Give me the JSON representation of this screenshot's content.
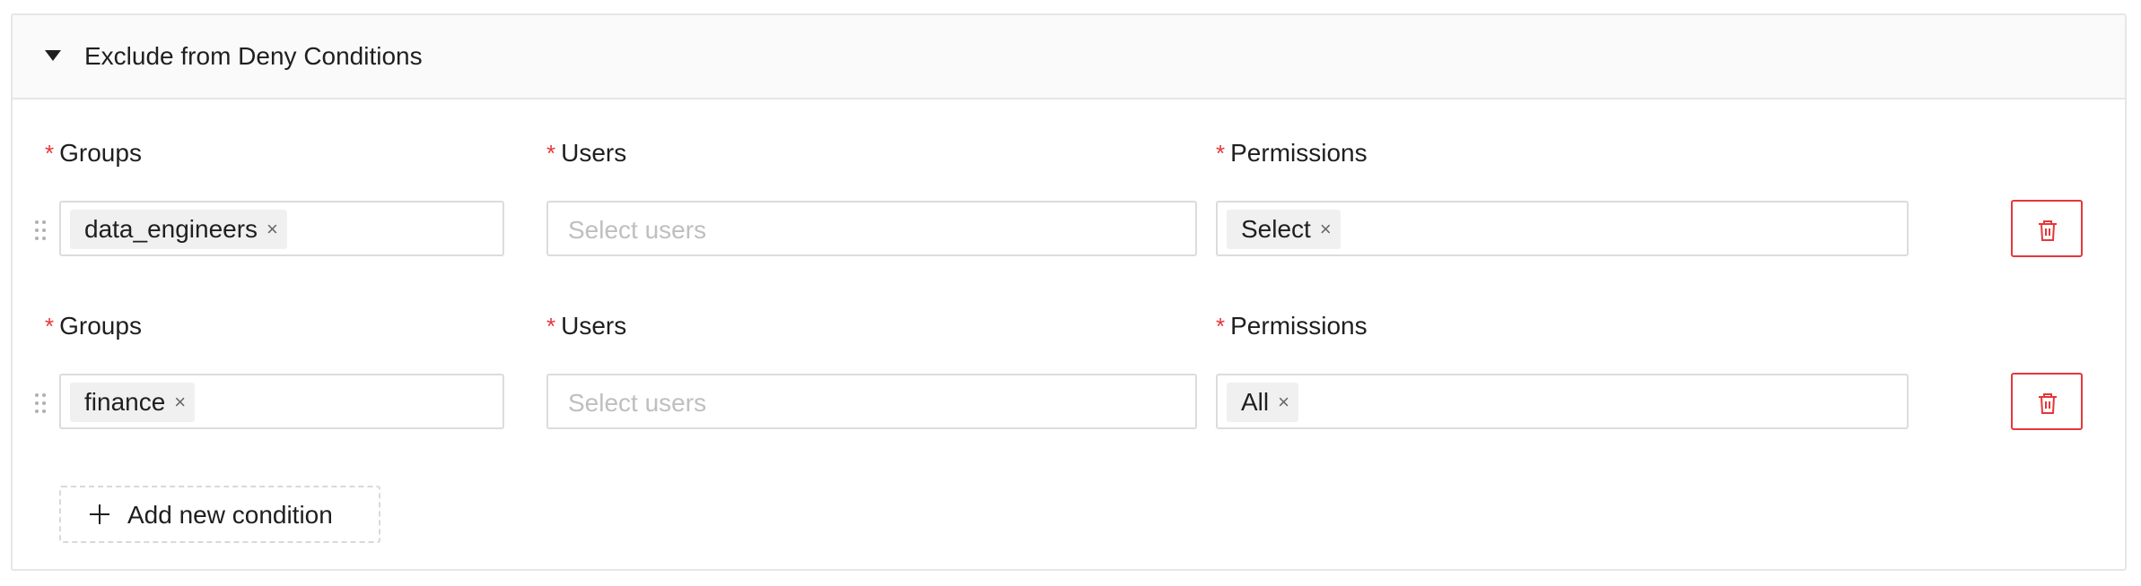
{
  "panel": {
    "title": "Exclude from Deny Conditions",
    "caret_icon": "caret-down-icon"
  },
  "labels": {
    "required_mark": "*",
    "groups": "Groups",
    "users": "Users",
    "permissions": "Permissions"
  },
  "conditions": [
    {
      "groups": [
        "data_engineers"
      ],
      "users_placeholder": "Select users",
      "permissions": [
        "Select"
      ]
    },
    {
      "groups": [
        "finance"
      ],
      "users_placeholder": "Select users",
      "permissions": [
        "All"
      ]
    }
  ],
  "tag_remove_glyph": "×",
  "add_button": {
    "label": "Add new condition",
    "icon": "plus-icon"
  },
  "colors": {
    "required": "#e5373a",
    "danger": "#e5373a",
    "border": "#dcdcdc",
    "header_bg": "#fafafa",
    "tag_bg": "#f0f0f0",
    "placeholder": "#bfbfbf"
  }
}
